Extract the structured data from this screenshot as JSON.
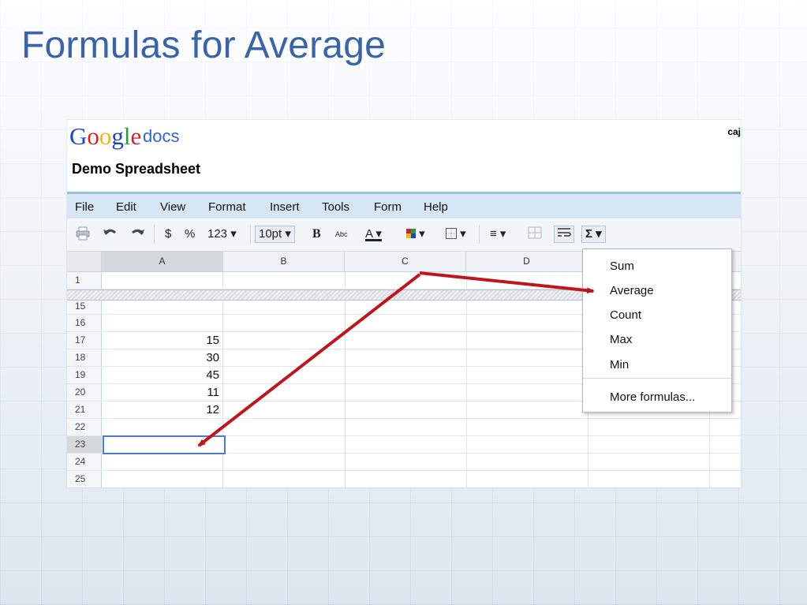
{
  "slide": {
    "title": "Formulas for Average"
  },
  "app": {
    "logo_letters": [
      {
        "ch": "G",
        "color": "#1a46c0"
      },
      {
        "ch": "o",
        "color": "#d6212a"
      },
      {
        "ch": "o",
        "color": "#f1b70b"
      },
      {
        "ch": "g",
        "color": "#1a46c0"
      },
      {
        "ch": "l",
        "color": "#2a9b3a"
      },
      {
        "ch": "e",
        "color": "#d6212a"
      }
    ],
    "product": "docs",
    "user_fragment": "caj",
    "document_title": "Demo Spreadsheet"
  },
  "menu": [
    "File",
    "Edit",
    "View",
    "Format",
    "Insert",
    "Tools",
    "Form",
    "Help"
  ],
  "toolbar": {
    "print_icon": "print-icon",
    "undo_icon": "undo-icon",
    "redo_icon": "redo-icon",
    "currency": "$",
    "percent": "%",
    "number_format": "123 ▾",
    "font_size": "10pt ▾",
    "bold": "B",
    "strikethrough": "Abc",
    "text_color": "A ▾",
    "bg_color": "▾",
    "borders": "▾",
    "align": "≡ ▾",
    "sum": "Σ ▾"
  },
  "columns": [
    "A",
    "B",
    "C",
    "D"
  ],
  "rows": [
    {
      "num": "1",
      "a": ""
    },
    {
      "num": "15",
      "a": ""
    },
    {
      "num": "16",
      "a": ""
    },
    {
      "num": "17",
      "a": "15"
    },
    {
      "num": "18",
      "a": "30"
    },
    {
      "num": "19",
      "a": "45"
    },
    {
      "num": "20",
      "a": "11"
    },
    {
      "num": "21",
      "a": "12"
    },
    {
      "num": "22",
      "a": ""
    },
    {
      "num": "23",
      "a": ""
    },
    {
      "num": "24",
      "a": ""
    },
    {
      "num": "25",
      "a": ""
    }
  ],
  "dropdown": {
    "items": [
      "Sum",
      "Average",
      "Count",
      "Max",
      "Min"
    ],
    "more": "More formulas..."
  },
  "colors": {
    "title": "#3a63a9",
    "arrow": "#c0161b",
    "menubar": "#d7e6f4"
  }
}
